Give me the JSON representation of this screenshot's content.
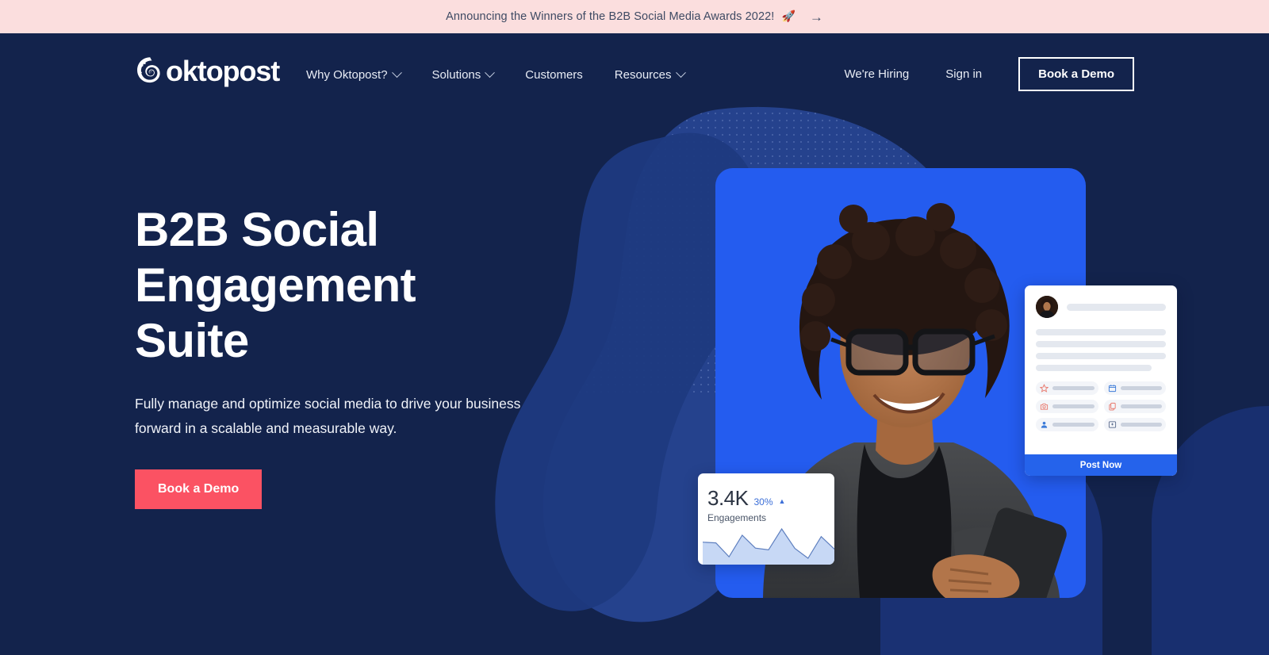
{
  "announcement": {
    "text": "Announcing the Winners of the B2B Social Media Awards 2022!",
    "rocket_icon": "rocket-icon",
    "arrow_icon": "arrow-right-icon",
    "arrow_glyph": "→",
    "rocket_glyph": "🚀",
    "background": "#FBDEDE",
    "text_color": "#3E4A63"
  },
  "header": {
    "logo_text": "oktopost",
    "logo_mark": "octopus-spiral-icon",
    "nav": [
      {
        "label": "Why Oktopost?",
        "has_dropdown": true
      },
      {
        "label": "Solutions",
        "has_dropdown": true
      },
      {
        "label": "Customers",
        "has_dropdown": false
      },
      {
        "label": "Resources",
        "has_dropdown": true
      }
    ],
    "right_links": [
      {
        "label": "We're Hiring"
      },
      {
        "label": "Sign in"
      }
    ],
    "cta_label": "Book a Demo"
  },
  "hero": {
    "title_lines": [
      "B2B Social",
      "Engagement",
      "Suite"
    ],
    "title_full": "B2B Social Engagement Suite",
    "subtitle": "Fully manage and optimize social media to drive your business forward in a scalable and measurable way.",
    "cta_label": "Book a Demo",
    "cta_color": "#FB5263"
  },
  "composer_card": {
    "post_button_label": "Post Now",
    "post_button_color": "#2563EB",
    "avatar": "user-avatar",
    "chips": [
      {
        "icon": "star-icon",
        "color": "#E8776B"
      },
      {
        "icon": "calendar-icon",
        "color": "#3C7BD8"
      },
      {
        "icon": "camera-icon",
        "color": "#E8776B"
      },
      {
        "icon": "document-copy-icon",
        "color": "#E8776B"
      },
      {
        "icon": "user-profile-icon",
        "color": "#3C7BD8"
      },
      {
        "icon": "image-card-icon",
        "color": "#5A6B8C"
      }
    ]
  },
  "stats_card": {
    "value": "3.4K",
    "delta": "30%",
    "delta_caret": "▲",
    "label": "Engagements",
    "delta_color": "#3C6FD8"
  },
  "chart_data": {
    "type": "area",
    "title": "Engagements",
    "x": [
      0,
      1,
      2,
      3,
      4,
      5,
      6,
      7,
      8,
      9,
      10
    ],
    "values": [
      62,
      60,
      20,
      82,
      45,
      40,
      100,
      44,
      16,
      78,
      42
    ],
    "ylim": [
      0,
      100
    ],
    "grid": false,
    "legend": false,
    "line_color": "#5E7FBF",
    "fill_color": "#C7D8F5"
  },
  "colors": {
    "navy_bg": "#13234C",
    "mid_blue_blob": "#1A3173",
    "light_blue_blob": "#2B4A9E",
    "bright_blue": "#245CEF",
    "accent_red": "#FB5263",
    "banner_pink": "#FBDEDE"
  }
}
